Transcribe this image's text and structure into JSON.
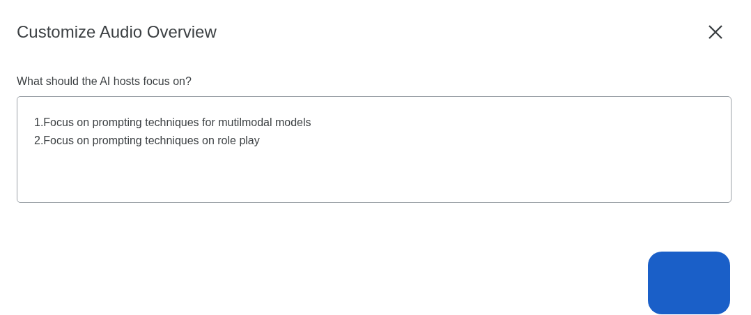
{
  "dialog": {
    "title": "Customize Audio Overview",
    "prompt": {
      "label": "What should the AI hosts focus on?",
      "value": "1.Focus on prompting techniques for mutilmodal models\n2.Focus on prompting techniques on role play"
    },
    "buttons": [
      {
        "kind": "primary"
      }
    ]
  }
}
